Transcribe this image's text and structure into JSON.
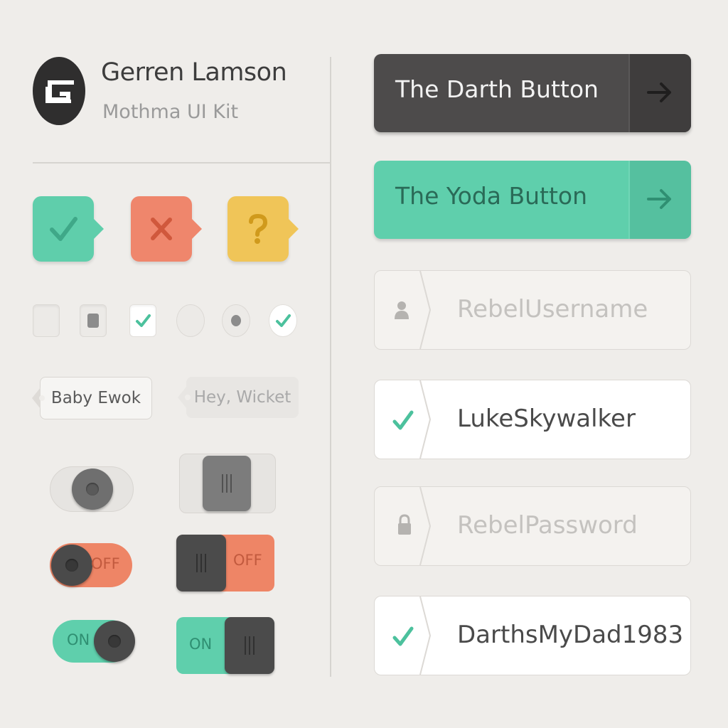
{
  "header": {
    "author": "Gerren Lamson",
    "kit_name": "Mothma UI Kit",
    "logo_icon": "g-monogram-logo"
  },
  "badges": [
    {
      "name": "success",
      "icon": "check-icon",
      "color": "#5fceab"
    },
    {
      "name": "error",
      "icon": "x-icon",
      "color": "#ef866c"
    },
    {
      "name": "question",
      "icon": "question-icon",
      "color": "#f0c558"
    }
  ],
  "checks": {
    "checkbox_states": [
      "unchecked",
      "partial",
      "checked"
    ],
    "radio_states": [
      "unchecked",
      "partial",
      "checked"
    ]
  },
  "tags": {
    "baby": "Baby Ewok",
    "hey": "Hey, Wicket"
  },
  "toggles": {
    "off_label": "OFF",
    "on_label": "ON"
  },
  "buttons": {
    "darth": "The Darth Button",
    "yoda": "The Yoda Button",
    "arrow_icon": "arrow-right-icon"
  },
  "fields": {
    "username": {
      "placeholder": "RebelUsername",
      "icon": "user-icon"
    },
    "luke": {
      "value": "LukeSkywalker",
      "icon": "check-icon"
    },
    "password": {
      "placeholder": "RebelPassword",
      "icon": "lock-icon"
    },
    "darth": {
      "value": "DarthsMyDad1983",
      "icon": "check-icon"
    }
  },
  "colors": {
    "teal": "#5fcfac",
    "coral": "#ee8566",
    "yellow": "#f0c558",
    "dark": "#4d4b4b",
    "background": "#efedea"
  }
}
